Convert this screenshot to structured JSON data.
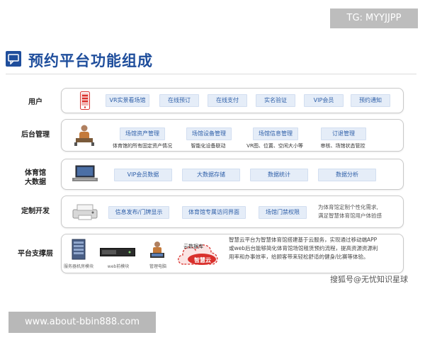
{
  "watermark_top": "TG: MYYJJPP",
  "title": "预约平台功能组成",
  "rows": {
    "user": {
      "label": "用户",
      "pills": [
        "VR实景看场馆",
        "在线预订",
        "在线支付",
        "实名验证",
        "VIP会员",
        "预约通知"
      ]
    },
    "backend": {
      "label": "后台管理",
      "pills": [
        "场馆资产管理",
        "场馆设备管理",
        "场馆信息管理",
        "订退管理"
      ],
      "subs": [
        "体育馆的所有固定资产情况",
        "智能化设备联动",
        "VR图、位置、空闲大小等",
        "审核、场馆状态管控"
      ]
    },
    "bigdata": {
      "label_line1": "体育馆",
      "label_line2": "大数据",
      "pills": [
        "VIP会员数据",
        "大数据存储",
        "数据统计",
        "数据分析"
      ]
    },
    "custom": {
      "label": "定制开发",
      "pills": [
        "信息发布/门牌显示",
        "体育馆专属访问界面",
        "场馆门禁权限"
      ],
      "desc_line1": "为体育馆定制个性化需求,",
      "desc_line2": "满足智慧体育馆用户体验感"
    },
    "support": {
      "label": "平台支撑层",
      "captions": [
        "服务器机房模块",
        "web前模块",
        "管理电脑"
      ],
      "cloud_top": "云数据库",
      "cloud_main": "智慧云",
      "desc_lines": [
        "智慧云平台为智慧体育馆搭建基于云服务，实现通过移动端APP",
        "或web后台能够简化体育馆场馆租赁预约流程，提高资源资源利",
        "用率和办事效率，给顾客带来轻松舒适的健身/比赛等体验。"
      ]
    }
  },
  "watermark_bottom_right": "搜狐号@无忧知识星球",
  "watermark_bottom_left": "www.about-bbin888.com",
  "colors": {
    "accent": "#1f4e9c",
    "pill_bg": "#e5edf8",
    "pill_text": "#2e5fa8",
    "cloud_red": "#d9302c"
  },
  "icons": [
    "chat-bubble-icon",
    "phone-icon",
    "worker-icon",
    "monitor-icon",
    "printer-icon",
    "server-rack-icon",
    "web-server-icon",
    "computer-user-icon",
    "cloud-icon"
  ]
}
